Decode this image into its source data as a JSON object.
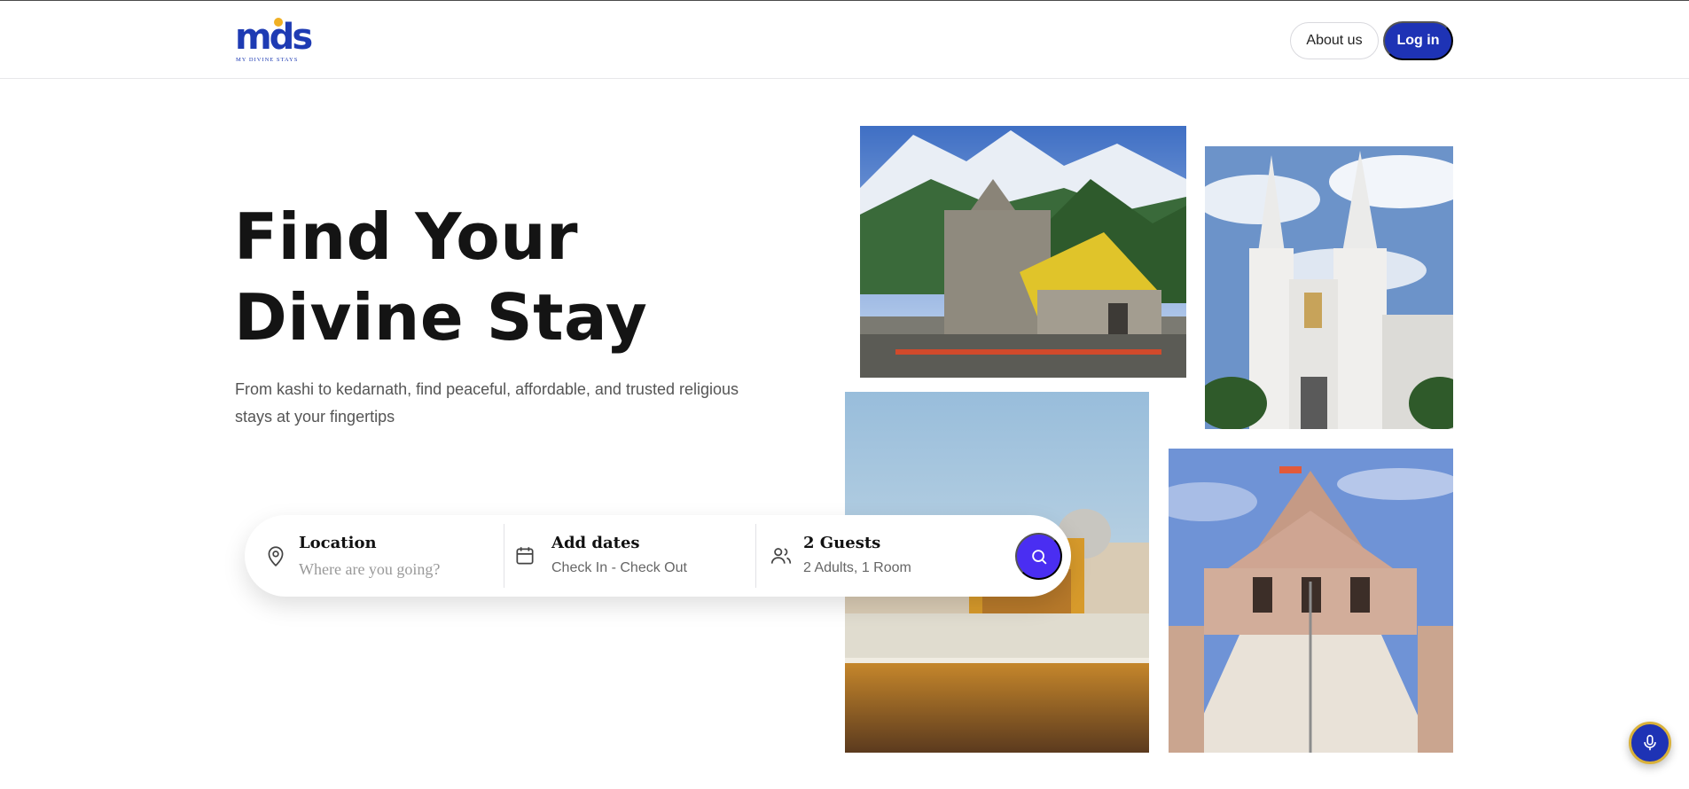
{
  "header": {
    "logo": {
      "word": "mds",
      "tagline": "MY DIVINE STAYS"
    },
    "about_label": "About us",
    "login_label": "Log in"
  },
  "hero": {
    "title_line1": "Find Your",
    "title_line2": "Divine Stay",
    "subtitle_line1": "From kashi to kedarnath, find peaceful, affordable, and trusted religious",
    "subtitle_line2": "stays at your fingertips"
  },
  "search": {
    "location": {
      "title": "Location",
      "placeholder": "Where are you going?",
      "value": "",
      "icon": "map-pin-icon"
    },
    "dates": {
      "title": "Add dates",
      "subtitle": "Check In - Check Out",
      "icon": "calendar-icon"
    },
    "guests": {
      "title": "2 Guests",
      "subtitle": "2 Adults, 1 Room",
      "icon": "users-icon"
    },
    "search_icon": "search-icon"
  },
  "gallery": [
    {
      "name": "kedarnath-temple-photo"
    },
    {
      "name": "white-church-photo"
    },
    {
      "name": "golden-temple-photo"
    },
    {
      "name": "stone-temple-stairs-photo"
    }
  ],
  "floating": {
    "icon": "microphone-icon"
  },
  "colors": {
    "brand_blue": "#1e33b5",
    "search_purple": "#4a2ef2",
    "logo_accent": "#f0b024",
    "title_text": "#141414",
    "muted_text": "#555555"
  }
}
